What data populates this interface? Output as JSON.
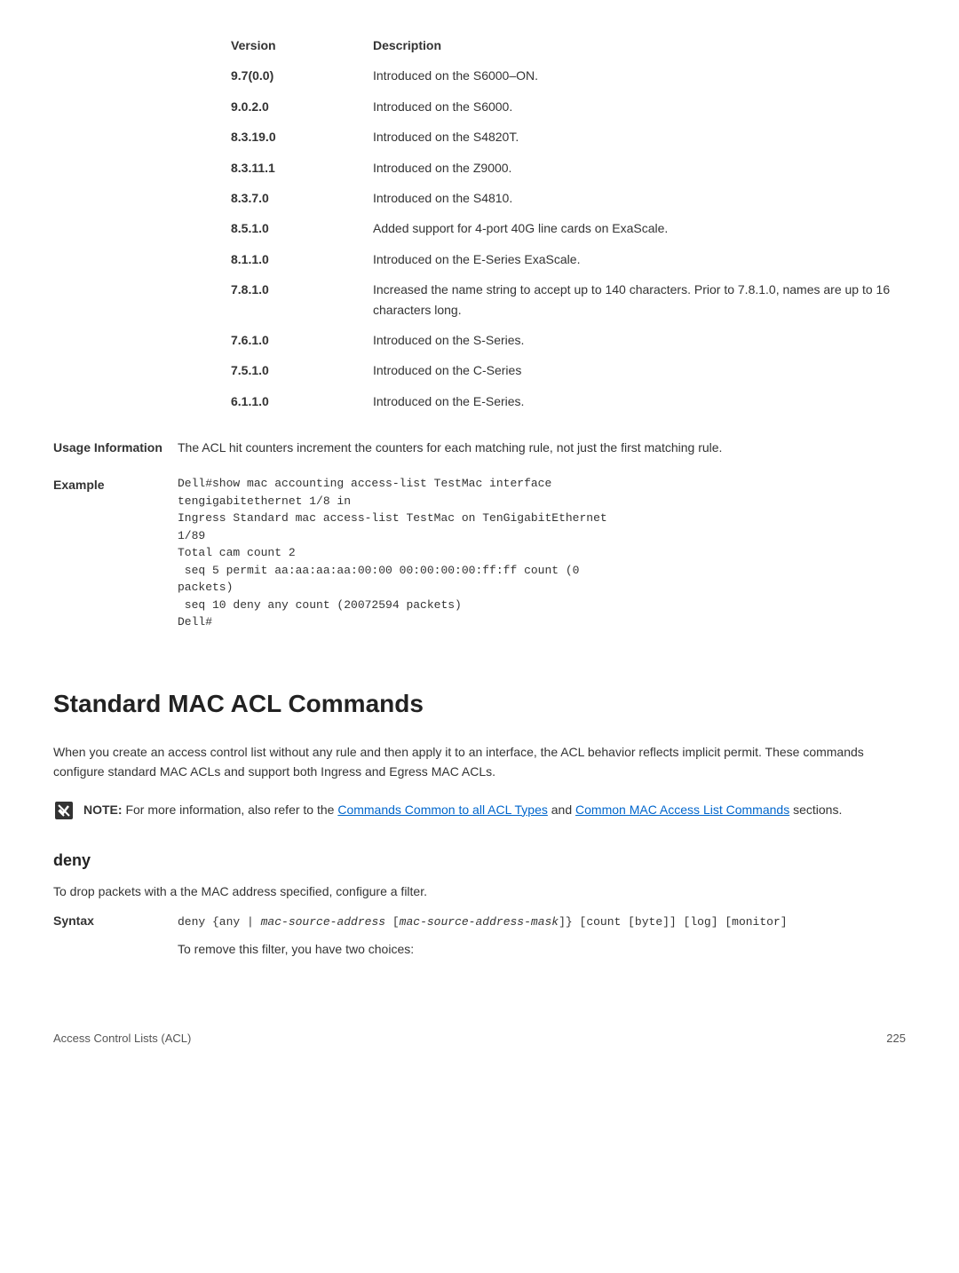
{
  "version_table": {
    "header_col1": "Version",
    "header_col2": "Description",
    "rows": [
      {
        "version": "9.7(0.0)",
        "desc": "Introduced on the S6000–ON."
      },
      {
        "version": "9.0.2.0",
        "desc": "Introduced on the S6000."
      },
      {
        "version": "8.3.19.0",
        "desc": "Introduced on the S4820T."
      },
      {
        "version": "8.3.11.1",
        "desc": "Introduced on the Z9000."
      },
      {
        "version": "8.3.7.0",
        "desc": "Introduced on the S4810."
      },
      {
        "version": "8.5.1.0",
        "desc": "Added support for 4-port 40G line cards on ExaScale."
      },
      {
        "version": "8.1.1.0",
        "desc": "Introduced on the E-Series ExaScale."
      },
      {
        "version": "7.8.1.0",
        "desc": "Increased the name string to accept up to 140 characters. Prior to 7.8.1.0, names are up to 16 characters long."
      },
      {
        "version": "7.6.1.0",
        "desc": "Introduced on the S-Series."
      },
      {
        "version": "7.5.1.0",
        "desc": "Introduced on the C-Series"
      },
      {
        "version": "6.1.1.0",
        "desc": "Introduced on the E-Series."
      }
    ]
  },
  "usage_info": {
    "label": "Usage Information",
    "text": "The ACL hit counters increment the counters for each matching rule, not just the first matching rule."
  },
  "example": {
    "label": "Example",
    "code": "Dell#show mac accounting access-list TestMac interface\ntengigabitethernet 1/8 in\nIngress Standard mac access-list TestMac on TenGigabitEthernet\n1/89\nTotal cam count 2\n seq 5 permit aa:aa:aa:aa:00:00 00:00:00:00:ff:ff count (0\npackets)\n seq 10 deny any count (20072594 packets)\nDell#"
  },
  "section": {
    "heading": "Standard MAC ACL Commands",
    "text": "When you create an access control list without any rule and then apply it to an interface, the ACL behavior reflects implicit permit. These commands configure standard MAC ACLs and support both Ingress and Egress MAC ACLs."
  },
  "note": {
    "prefix": "NOTE: ",
    "text_before_link1": "For more information, also refer to the ",
    "link1": "Commands Common to all ACL Types",
    "text_middle": " and ",
    "link2": "Common MAC Access List Commands",
    "text_after": " sections."
  },
  "subsection": {
    "heading": "deny",
    "text": "To drop packets with a the MAC address specified, configure a filter."
  },
  "syntax": {
    "label": "Syntax",
    "code_part1": "deny {any | ",
    "code_italic1": "mac-source-address",
    "code_part2": " [",
    "code_italic2": "mac-source-address-mask",
    "code_part3": "]} [count [byte]] [log] [monitor]",
    "text": "To remove this filter, you have two choices:"
  },
  "footer": {
    "left": "Access Control Lists (ACL)",
    "right": "225"
  }
}
